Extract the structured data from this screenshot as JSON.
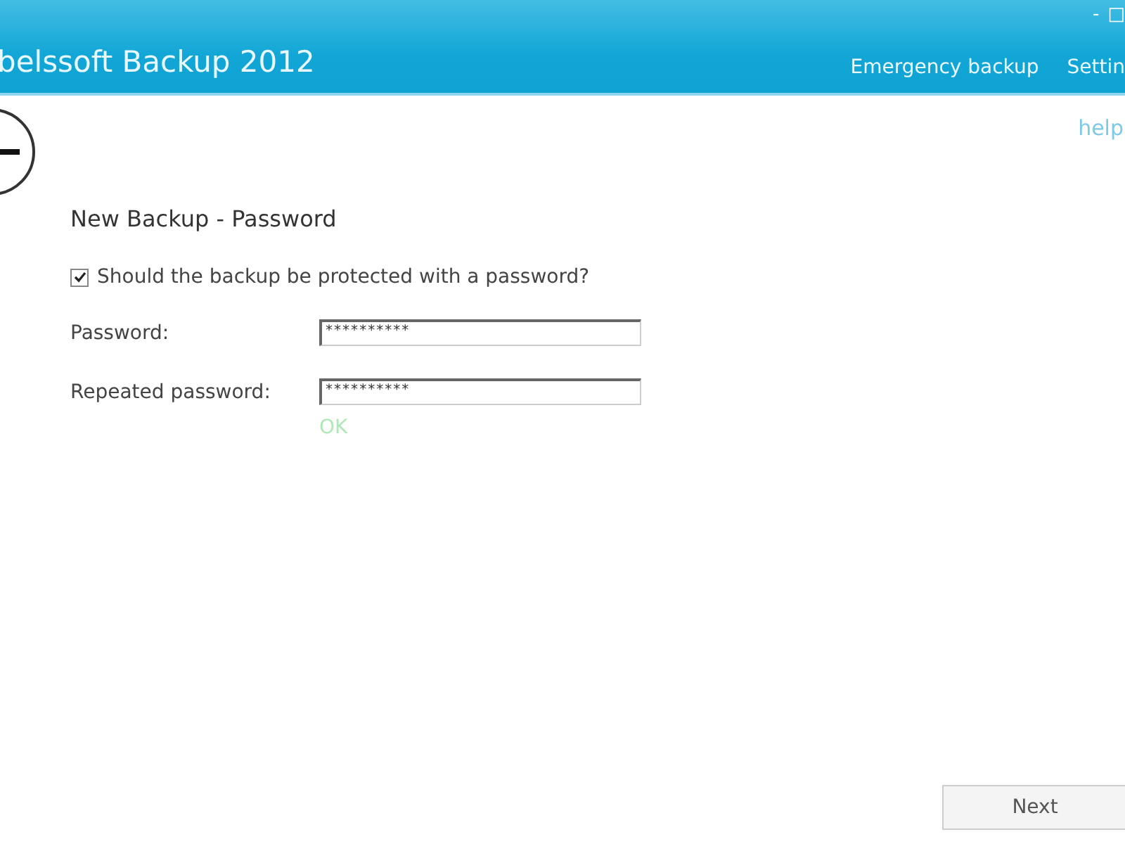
{
  "window": {
    "title": "belssoft Backup 2012",
    "controls": [
      "-",
      "□"
    ]
  },
  "nav": [
    "Emergency backup",
    "Settin"
  ],
  "help": "help",
  "heading": "New Backup - Password",
  "protect": {
    "label": "Should the backup be protected with a password?",
    "checked": true
  },
  "fields": [
    {
      "label": "Password:",
      "value": "**********"
    },
    {
      "label": "Repeated password:",
      "value": "**********"
    }
  ],
  "status": "OK",
  "next": "Next"
}
